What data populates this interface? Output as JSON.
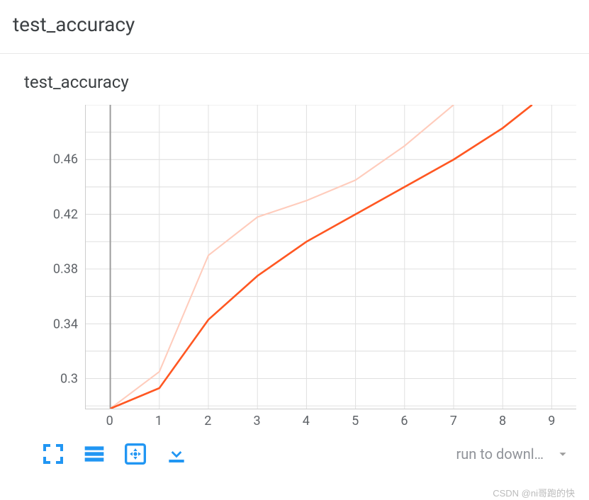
{
  "section_title": "test_accuracy",
  "chart_data": {
    "type": "line",
    "title": "test_accuracy",
    "xlabel": "",
    "ylabel": "",
    "xlim": [
      -0.5,
      9.5
    ],
    "ylim": [
      0.278,
      0.5
    ],
    "x_ticks": [
      0,
      1,
      2,
      3,
      4,
      5,
      6,
      7,
      8,
      9
    ],
    "y_ticks": [
      0.3,
      0.34,
      0.38,
      0.42,
      0.46
    ],
    "series": [
      {
        "name": "test_accuracy (smoothed)",
        "x": [
          0,
          1,
          2,
          3,
          4,
          5,
          6,
          7,
          8,
          8.6
        ],
        "values": [
          0.278,
          0.293,
          0.343,
          0.375,
          0.4,
          0.42,
          0.44,
          0.46,
          0.483,
          0.5
        ],
        "color": "#ff5722"
      },
      {
        "name": "test_accuracy (raw)",
        "x": [
          0,
          1,
          2,
          3,
          4,
          5,
          6,
          7
        ],
        "values": [
          0.278,
          0.305,
          0.39,
          0.418,
          0.43,
          0.445,
          0.47,
          0.5
        ],
        "color": "#ffccbc"
      }
    ]
  },
  "toolbar": {
    "download_select_label": "run to downl…"
  },
  "watermark": "CSDN @ni哥跑的快"
}
